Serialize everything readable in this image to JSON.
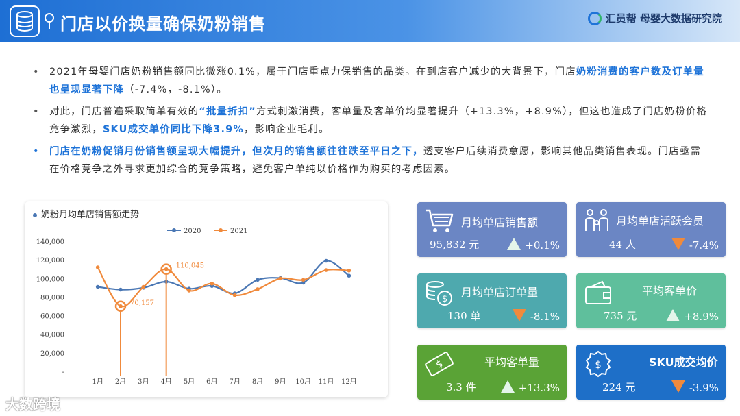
{
  "header": {
    "title": "门店以价换量确保奶粉销售",
    "brand": "汇员帮 母婴大数据研究院"
  },
  "bullets": [
    {
      "pre": "2021年母婴门店奶粉销售额同比微涨0.1%，属于门店重点力保销售的品类。在到店客户减少的大背景下，门店",
      "hl": "奶粉消费的客户数及订单量也呈现显著下降",
      "post": "（-7.4%，-8.1%）。"
    },
    {
      "pre": "对此，门店普遍采取简单有效的",
      "hl": "“批量折扣”",
      "mid": "方式刺激消费，客单量及客单价均显著提升（+13.3%，+8.9%），但这也造成了门店奶粉价格竞争激烈，",
      "hl2": "SKU成交单价同比下降3.9%",
      "post": "，影响企业毛利。"
    },
    {
      "hl": "门店在奶粉促销月份销售额呈现大幅提升，但次月的销售额往往跌至平日之下，",
      "post": "透支客户后续消费意愿，影响其他品类销售表现。门店亟需在价格竞争之外寻求更加综合的竞争策略，避免客户单纯以价格作为购买的考虑因素。"
    }
  ],
  "chart_title": "奶粉月均单店销售额走势",
  "chart_data": {
    "type": "line",
    "title": "奶粉月均单店销售额走势",
    "categories": [
      "1月",
      "2月",
      "3月",
      "4月",
      "5月",
      "6月",
      "7月",
      "8月",
      "9月",
      "10月",
      "11月",
      "12月"
    ],
    "series": [
      {
        "name": "2020",
        "values": [
          91000,
          88000,
          90000,
          96500,
          89000,
          92000,
          84000,
          98500,
          100500,
          95500,
          119000,
          103000
        ],
        "color": "#4a77b4"
      },
      {
        "name": "2021",
        "values": [
          112000,
          70157,
          91000,
          110045,
          87000,
          94500,
          82000,
          88500,
          100000,
          98500,
          109000,
          108500
        ],
        "color": "#f08a3c"
      }
    ],
    "yticks": [
      "-",
      "20,000",
      "40,000",
      "60,000",
      "80,000",
      "100,000",
      "120,000",
      "140,000"
    ],
    "ylim": [
      0,
      140000
    ],
    "annotations": [
      {
        "category": "2月",
        "series": "2021",
        "label": "70,157"
      },
      {
        "category": "4月",
        "series": "2021",
        "label": "110,045"
      }
    ],
    "legend": "top"
  },
  "kpis": [
    {
      "label": "月均单店销售额",
      "value": "95,832 元",
      "change": "+0.1%",
      "direction": "up",
      "icon": "shopping-cart-icon",
      "color": "#6b86c4"
    },
    {
      "label": "月均单店活跃会员",
      "value": "44 人",
      "change": "-7.4%",
      "direction": "down",
      "icon": "family-icon",
      "color": "#6b86c4"
    },
    {
      "label": "月均单店订单量",
      "value": "130 单",
      "change": "-8.1%",
      "direction": "down",
      "icon": "coins-icon",
      "color": "#4ea9ae"
    },
    {
      "label": "平均客单价",
      "value": "735 元",
      "change": "+8.9%",
      "direction": "up",
      "icon": "wallet-icon",
      "color": "#5fbf9c"
    },
    {
      "label": "平均客单量",
      "value": "3.3 件",
      "change": "+13.3%",
      "direction": "up",
      "icon": "money-bill-icon",
      "color": "#5aa336"
    },
    {
      "label": "SKU成交均价",
      "value": "224 元",
      "change": "-3.9%",
      "direction": "down",
      "icon": "dollar-badge-icon",
      "color": "#1e6fc8"
    }
  ],
  "footer": "大数跨境"
}
